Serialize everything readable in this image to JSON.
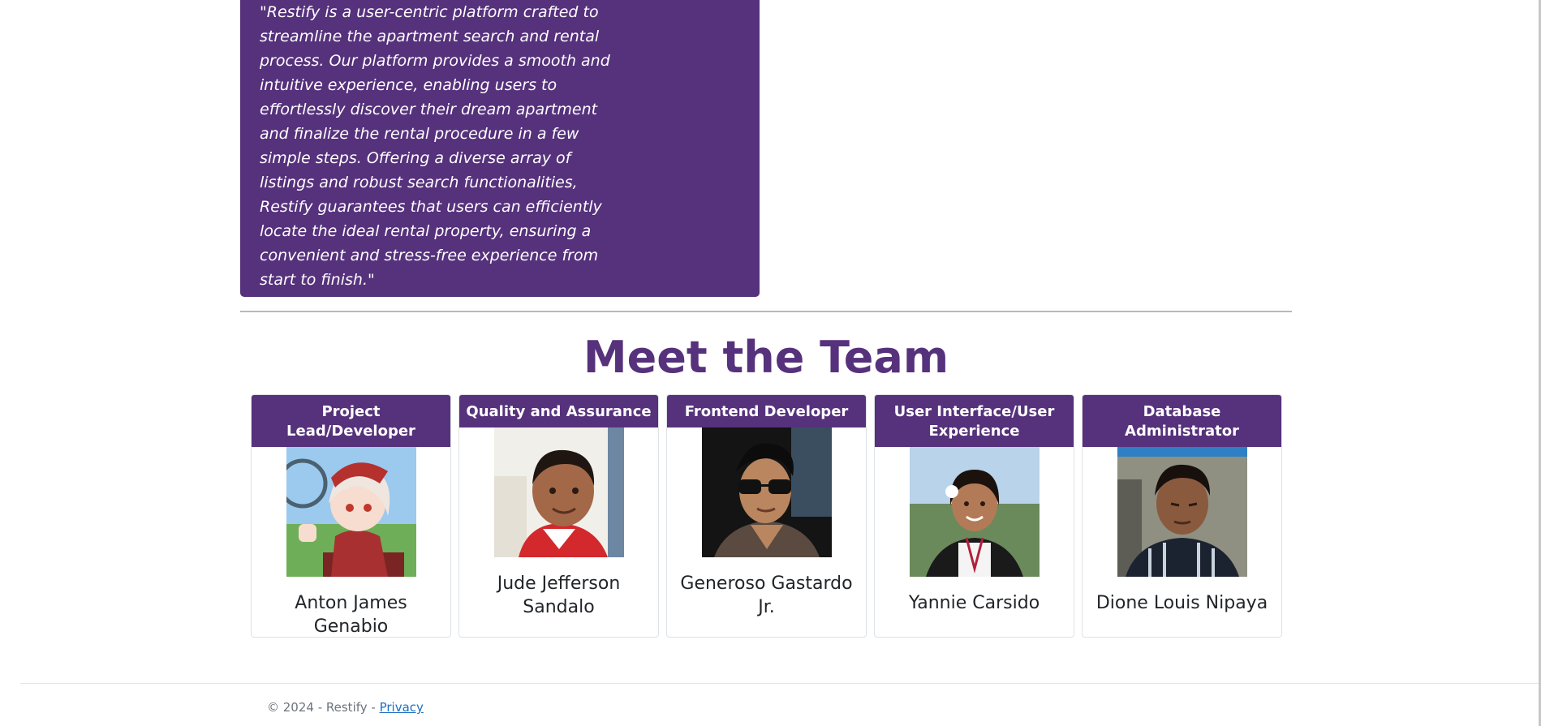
{
  "about": {
    "text": "\"Restify is a user-centric platform crafted to streamline the apartment search and rental process. Our platform provides a smooth and intuitive experience, enabling users to effortlessly discover their dream apartment and finalize the rental procedure in a few simple steps. Offering a diverse array of listings and robust search functionalities, Restify guarantees that users can efficiently locate the ideal rental property, ensuring a convenient and stress-free experience from start to finish.\""
  },
  "team": {
    "title": "Meet the Team",
    "members": [
      {
        "role": "Project Lead/Developer",
        "name": "Anton James Genabio"
      },
      {
        "role": "Quality and Assurance",
        "name": "Jude Jefferson Sandalo"
      },
      {
        "role": "Frontend Developer",
        "name": "Generoso Gastardo Jr."
      },
      {
        "role": "User Interface/User Experience",
        "name": "Yannie Carsido"
      },
      {
        "role": "Database Administrator",
        "name": "Dione Louis Nipaya"
      }
    ]
  },
  "footer": {
    "copyright": "© 2024 - Restify - ",
    "privacy_link": "Privacy"
  },
  "colors": {
    "brand": "#56317c",
    "link": "#1b6ec2"
  }
}
